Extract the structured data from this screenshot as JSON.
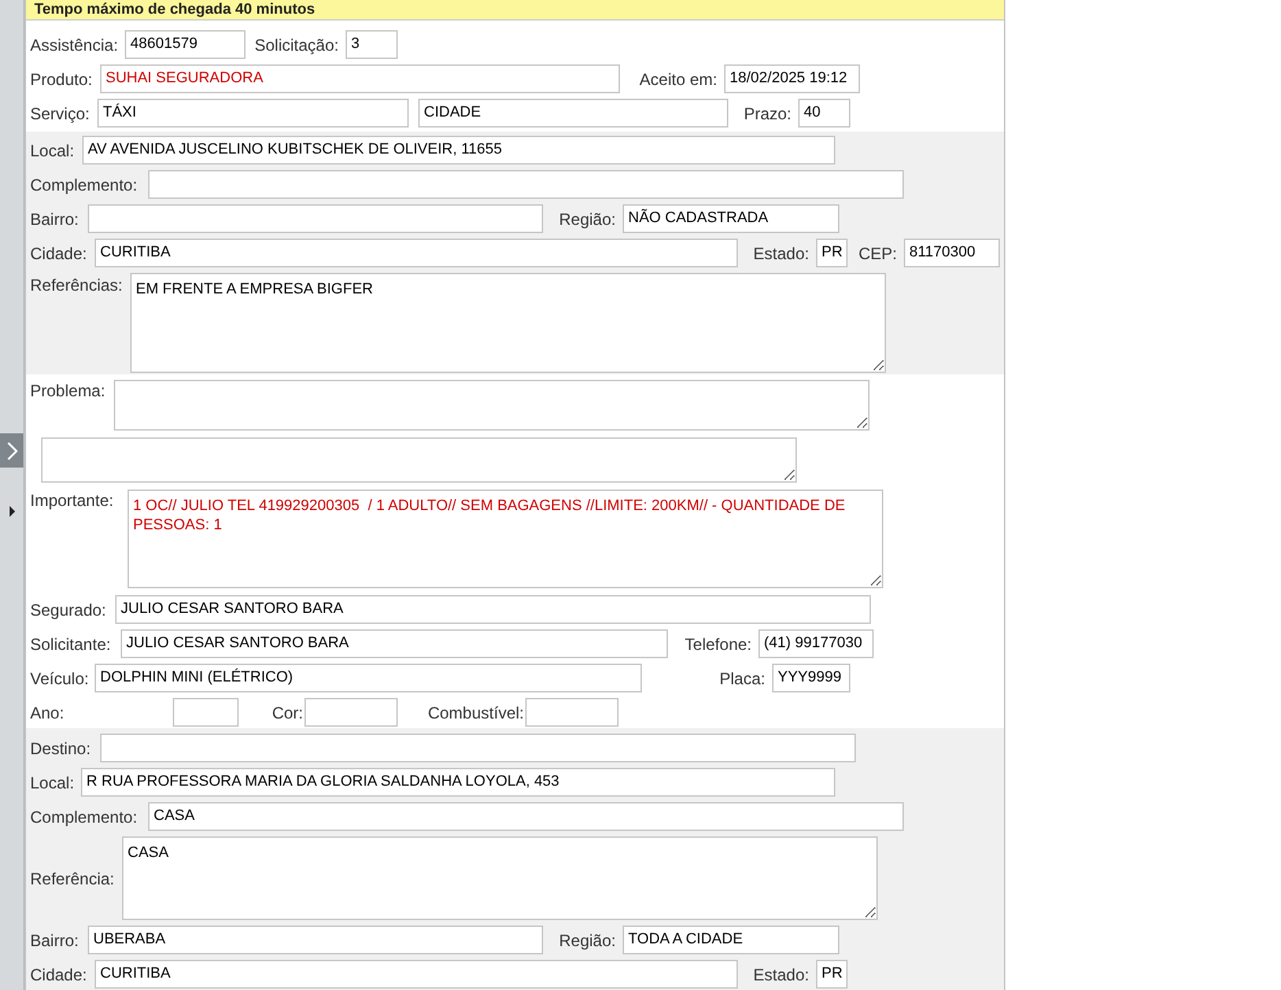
{
  "header": {
    "title": "Tempo máximo de chegada 40 minutos"
  },
  "sections": [
    {
      "shaded": false,
      "rows": [
        {
          "items": [
            {
              "kind": "label",
              "text": "Assistência:"
            },
            {
              "kind": "input",
              "value": "48601579",
              "alert": false
            },
            {
              "kind": "label",
              "text": "Solicitação:"
            },
            {
              "kind": "input",
              "value": "3",
              "alert": false
            }
          ]
        },
        {
          "items": [
            {
              "kind": "label",
              "text": "Produto:"
            },
            {
              "kind": "input",
              "value": "SUHAI SEGURADORA",
              "alert": true
            },
            {
              "kind": "label",
              "text": "Aceito em:"
            },
            {
              "kind": "input",
              "value": "18/02/2025 19:12",
              "alert": false
            }
          ]
        },
        {
          "items": [
            {
              "kind": "label",
              "text": "Serviço:"
            },
            {
              "kind": "input",
              "value": "TÁXI",
              "alert": false
            },
            {
              "kind": "input",
              "value": "CIDADE",
              "alert": false
            },
            {
              "kind": "label",
              "text": "Prazo:"
            },
            {
              "kind": "input",
              "value": "40",
              "alert": false
            }
          ]
        }
      ]
    },
    {
      "shaded": true,
      "rows": [
        {
          "items": [
            {
              "kind": "label",
              "text": "Local:"
            },
            {
              "kind": "input",
              "value": "AV AVENIDA JUSCELINO KUBITSCHEK DE OLIVEIR, 11655",
              "alert": false
            }
          ]
        },
        {
          "items": [
            {
              "kind": "label",
              "text": "Complemento:"
            },
            {
              "kind": "input"
            }
          ]
        },
        {
          "items": [
            {
              "kind": "label",
              "text": "Bairro:"
            },
            {
              "kind": "input"
            },
            {
              "kind": "label",
              "text": "Região:"
            },
            {
              "kind": "input",
              "value": "NÃO CADASTRADA",
              "alert": false
            }
          ]
        },
        {
          "items": [
            {
              "kind": "label",
              "text": "Cidade:"
            },
            {
              "kind": "input",
              "value": "CURITIBA",
              "alert": false
            },
            {
              "kind": "label",
              "text": "Estado:"
            },
            {
              "kind": "input",
              "value": "PR",
              "alert": false
            },
            {
              "kind": "label",
              "text": "CEP:"
            },
            {
              "kind": "input",
              "value": "81170300",
              "alert": false
            }
          ]
        },
        {
          "items": [
            {
              "kind": "label",
              "text": "Referências:"
            },
            {
              "kind": "textarea",
              "value": "EM FRENTE A EMPRESA BIGFER",
              "alert": false
            }
          ]
        }
      ]
    },
    {
      "shaded": false,
      "rows": [
        {
          "items": [
            {
              "kind": "label",
              "text": "Problema:"
            },
            {
              "kind": "textarea"
            }
          ]
        },
        {
          "items": [
            {
              "kind": "textarea"
            }
          ]
        },
        {
          "items": [
            {
              "kind": "label",
              "text": "Importante:"
            },
            {
              "kind": "textarea",
              "value": "1 OC// JULIO TEL 419929200305  / 1 ADULTO// SEM BAGAGENS //LIMITE: 200KM// - QUANTIDADE DE PESSOAS: 1",
              "alert": true
            }
          ]
        },
        {
          "items": [
            {
              "kind": "label",
              "text": "Segurado:"
            },
            {
              "kind": "input",
              "value": "JULIO CESAR SANTORO BARA",
              "alert": false
            }
          ]
        },
        {
          "items": [
            {
              "kind": "label",
              "text": "Solicitante:"
            },
            {
              "kind": "input",
              "value": "JULIO CESAR SANTORO BARA",
              "alert": false
            },
            {
              "kind": "label",
              "text": "Telefone:"
            },
            {
              "kind": "input",
              "value": "(41) 99177030",
              "alert": false
            }
          ]
        },
        {
          "items": [
            {
              "kind": "label",
              "text": "Veículo:"
            },
            {
              "kind": "input",
              "value": "DOLPHIN MINI (ELÉTRICO)",
              "alert": false
            },
            {
              "kind": "label",
              "text": "Placa:"
            },
            {
              "kind": "input",
              "value": "YYY9999",
              "alert": false
            }
          ]
        },
        {
          "items": [
            {
              "kind": "label",
              "text": "Ano:"
            },
            {
              "kind": "input"
            },
            {
              "kind": "label",
              "text": "Cor:"
            },
            {
              "kind": "input"
            },
            {
              "kind": "label",
              "text": "Combustível:"
            },
            {
              "kind": "input"
            }
          ]
        }
      ]
    },
    {
      "shaded": true,
      "rows": [
        {
          "items": [
            {
              "kind": "label",
              "text": "Destino:"
            },
            {
              "kind": "input"
            }
          ]
        },
        {
          "items": [
            {
              "kind": "label",
              "text": "Local:"
            },
            {
              "kind": "input",
              "value": "R RUA PROFESSORA MARIA DA GLORIA SALDANHA LOYOLA, 453",
              "alert": false
            }
          ]
        },
        {
          "items": [
            {
              "kind": "label",
              "text": "Complemento:"
            },
            {
              "kind": "input",
              "value": "CASA",
              "alert": false
            }
          ]
        },
        {
          "items": [
            {
              "kind": "label",
              "text": "Referência:"
            },
            {
              "kind": "textarea",
              "value": "CASA",
              "alert": false
            }
          ]
        },
        {
          "items": [
            {
              "kind": "label",
              "text": "Bairro:"
            },
            {
              "kind": "input",
              "value": "UBERABA",
              "alert": false
            },
            {
              "kind": "label",
              "text": "Região:"
            },
            {
              "kind": "input",
              "value": "TODA A CIDADE",
              "alert": false
            }
          ]
        },
        {
          "items": [
            {
              "kind": "label",
              "text": "Cidade:"
            },
            {
              "kind": "input",
              "value": "CURITIBA",
              "alert": false
            },
            {
              "kind": "label",
              "text": "Estado:"
            },
            {
              "kind": "input",
              "value": "PR",
              "alert": false
            }
          ]
        }
      ]
    }
  ]
}
